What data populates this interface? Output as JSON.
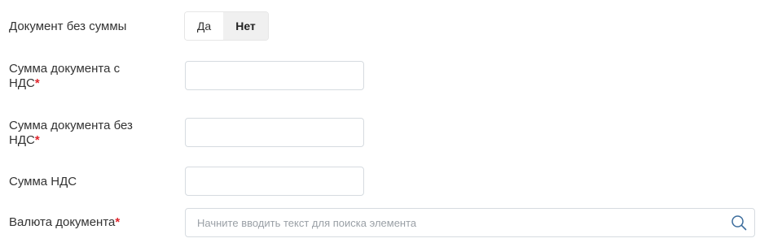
{
  "fields": {
    "no_sum": {
      "label": "Документ без суммы",
      "yes_label": "Да",
      "no_label": "Нет",
      "selected": "Нет"
    },
    "sum_with_vat": {
      "label_line1": "Сумма документа с",
      "label_line2": "НДС",
      "required_mark": "*",
      "value": ""
    },
    "sum_without_vat": {
      "label_line1": "Сумма документа без",
      "label_line2": "НДС",
      "required_mark": "*",
      "value": ""
    },
    "vat_sum": {
      "label": "Сумма НДС",
      "value": ""
    },
    "currency": {
      "label": "Валюта документа",
      "required_mark": "*",
      "placeholder": "Начните вводить текст для поиска элемента",
      "icon": "search-icon"
    }
  },
  "colors": {
    "required": "#e0262d",
    "placeholder": "#9aa0a6",
    "border": "#d6dbe0",
    "toggle_selected_bg": "#f0f0f0",
    "icon": "#3b6c9c"
  }
}
